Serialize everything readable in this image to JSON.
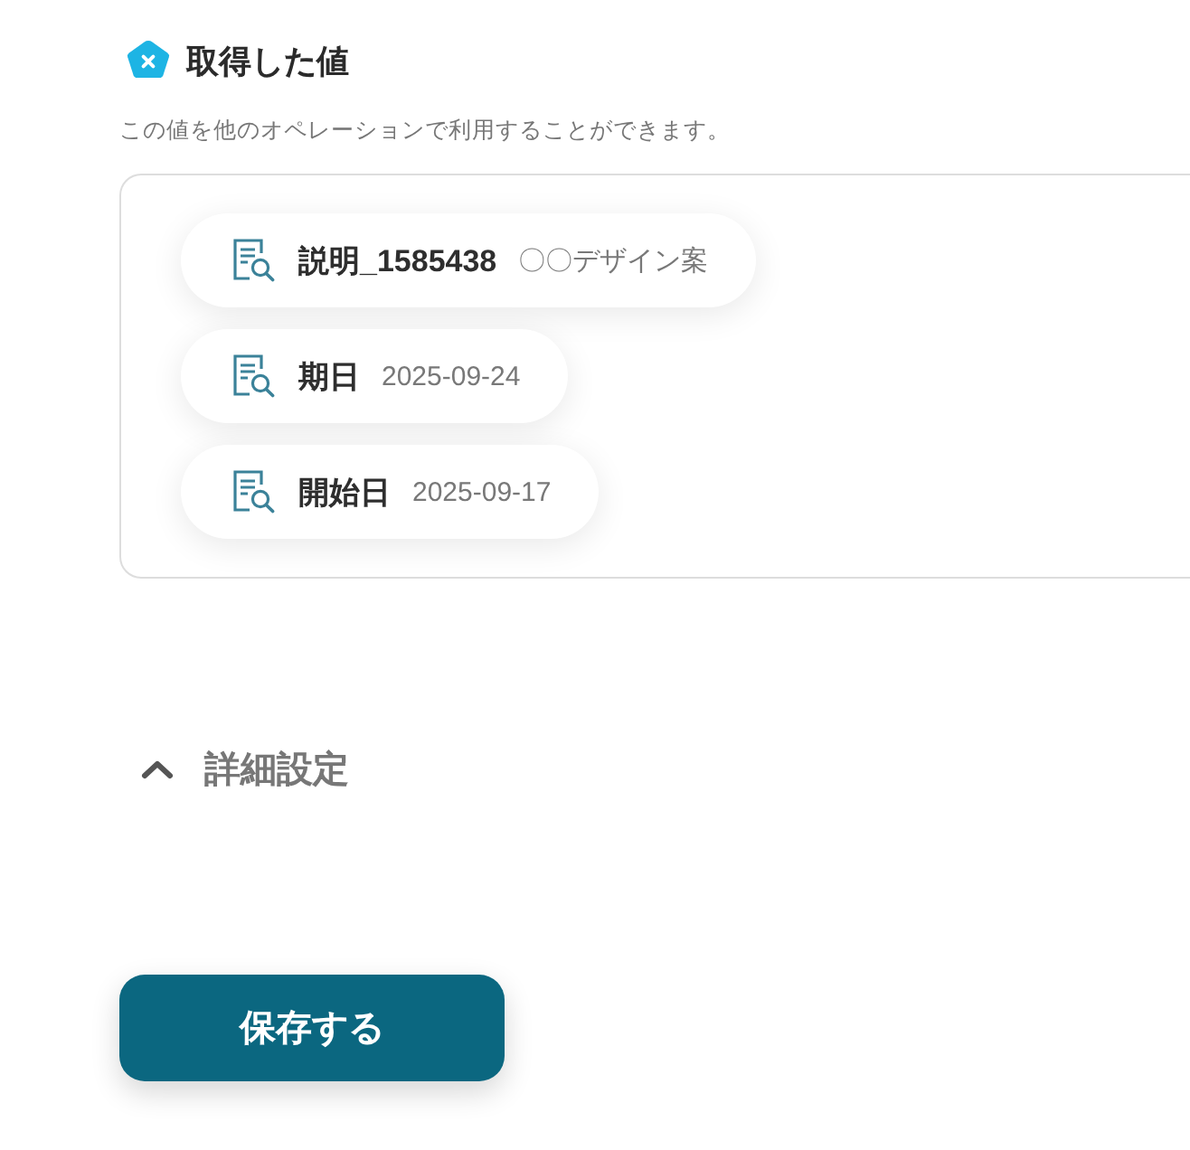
{
  "section": {
    "title": "取得した値",
    "description": "この値を他のオペレーションで利用することができます。"
  },
  "values": [
    {
      "label": "説明_1585438",
      "value": "〇〇デザイン案"
    },
    {
      "label": "期日",
      "value": "2025-09-24"
    },
    {
      "label": "開始日",
      "value": "2025-09-17"
    }
  ],
  "advanced": {
    "label": "詳細設定",
    "expanded": false
  },
  "save_button": {
    "label": "保存する"
  }
}
